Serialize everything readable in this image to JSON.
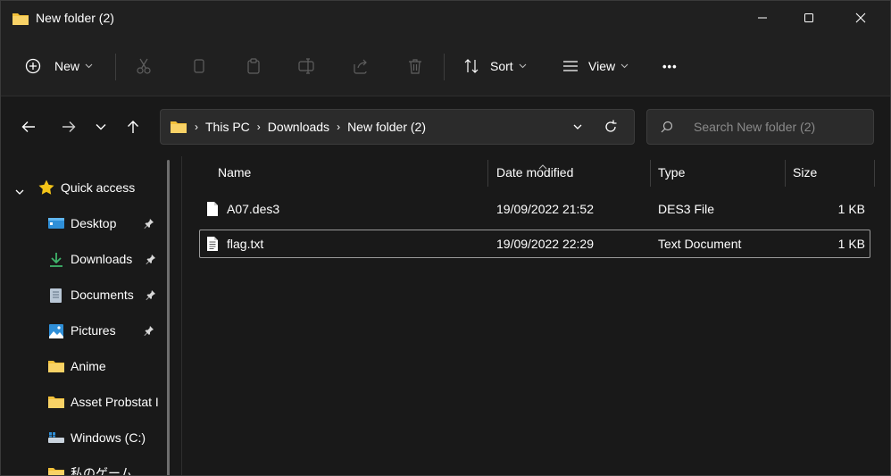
{
  "window": {
    "title": "New folder (2)"
  },
  "toolbar": {
    "new_label": "New",
    "sort_label": "Sort",
    "view_label": "View",
    "more_label": "•••",
    "icons": [
      "cut-icon",
      "copy-icon",
      "paste-icon",
      "rename-icon",
      "share-icon",
      "delete-icon"
    ]
  },
  "address": {
    "crumbs": [
      "This PC",
      "Downloads",
      "New folder (2)"
    ],
    "search_placeholder": "Search New folder (2)"
  },
  "sidebar": {
    "quick_access": "Quick access",
    "items": [
      {
        "label": "Desktop",
        "icon": "desktop-icon",
        "pinned": true
      },
      {
        "label": "Downloads",
        "icon": "downloads-icon",
        "pinned": true
      },
      {
        "label": "Documents",
        "icon": "documents-icon",
        "pinned": true
      },
      {
        "label": "Pictures",
        "icon": "pictures-icon",
        "pinned": true
      },
      {
        "label": "Anime",
        "icon": "folder-icon",
        "pinned": false
      },
      {
        "label": "Asset Probstat I",
        "icon": "folder-icon",
        "pinned": false
      },
      {
        "label": "Windows (C:)",
        "icon": "drive-icon",
        "pinned": false
      },
      {
        "label": "私のゲーム",
        "icon": "folder-icon",
        "pinned": false
      }
    ]
  },
  "files": {
    "columns": [
      "Name",
      "Date modified",
      "Type",
      "Size"
    ],
    "rows": [
      {
        "name": "A07.des3",
        "date": "19/09/2022 21:52",
        "type": "DES3 File",
        "size": "1 KB",
        "selected": false
      },
      {
        "name": "flag.txt",
        "date": "19/09/2022 22:29",
        "type": "Text Document",
        "size": "1 KB",
        "selected": true
      }
    ]
  },
  "colors": {
    "background": "#191919",
    "chrome": "#202020",
    "folder": "#f3c13a",
    "star": "#f5c518"
  }
}
